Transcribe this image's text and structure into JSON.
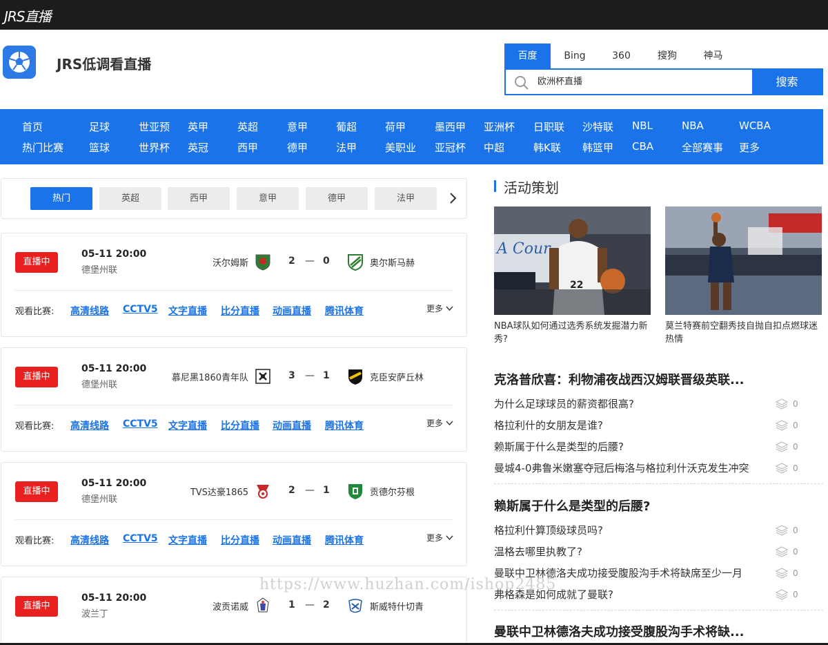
{
  "topbar": {
    "brand": "JRS直播"
  },
  "header": {
    "site_title": "JRS低调看直播",
    "brand_color": "#1a73e8",
    "search": {
      "engines": [
        "百度",
        "Bing",
        "360",
        "搜狗",
        "神马"
      ],
      "active_engine": "百度",
      "query": "欧洲杯直播",
      "button": "搜索"
    }
  },
  "nav": {
    "row1": [
      "首页",
      "足球",
      "世亚预",
      "英甲",
      "英超",
      "意甲",
      "葡超",
      "荷甲",
      "墨西甲",
      "亚洲杯",
      "日职联",
      "沙特联",
      "NBL",
      "NBA",
      "WCBA"
    ],
    "row2": [
      "热门比赛",
      "篮球",
      "世界杯",
      "英冠",
      "西甲",
      "德甲",
      "法甲",
      "美职业",
      "亚冠杯",
      "中超",
      "韩K联",
      "韩篮甲",
      "CBA",
      "全部赛事",
      "更多"
    ]
  },
  "filter_tabs": [
    "热门",
    "英超",
    "西甲",
    "意甲",
    "德甲",
    "法甲"
  ],
  "matches": [
    {
      "status": "直播中",
      "time": "05-11 20:00",
      "league": "德堡州联",
      "home": "沃尔姆斯",
      "home_score": "2",
      "away_score": "0",
      "away": "奥尔斯马赫"
    },
    {
      "status": "直播中",
      "time": "05-11 20:00",
      "league": "德堡州联",
      "home": "慕尼黑1860青年队",
      "home_score": "3",
      "away_score": "1",
      "away": "克臣安萨丘林"
    },
    {
      "status": "直播中",
      "time": "05-11 20:00",
      "league": "德堡州联",
      "home": "TVS达豪1865",
      "home_score": "2",
      "away_score": "1",
      "away": "贡德尔芬根"
    },
    {
      "status": "直播中",
      "time": "05-11 20:00",
      "league": "波兰丁",
      "home": "波贡诺威",
      "home_score": "1",
      "away_score": "2",
      "away": "斯威特什切青"
    }
  ],
  "watch": {
    "label": "观看比赛:",
    "links": [
      "高清线路",
      "CCTV5",
      "文字直播",
      "比分直播",
      "动画直播",
      "腾讯体育"
    ],
    "more": "更多"
  },
  "sidebar": {
    "section_title": "活动策划",
    "promos": [
      {
        "caption": "NBA球队如何通过选秀系统发掘潜力新秀?"
      },
      {
        "caption": "莫兰特赛前空翻秀技自抛自扣点燃球迷热情"
      }
    ],
    "news_groups": [
      {
        "headline": "克洛普欣喜：利物浦夜战西汉姆联晋级英联...",
        "items": [
          {
            "title": "为什么足球球员的薪资都很高?",
            "count": "0"
          },
          {
            "title": "格拉利什的女朋友是谁?",
            "count": "0"
          },
          {
            "title": "赖斯属于什么是类型的后腰?",
            "count": "0"
          },
          {
            "title": "曼城4-0弗鲁米嫩塞夺冠后梅洛与格拉利什沃克发生冲突",
            "count": "0"
          }
        ]
      },
      {
        "headline": "赖斯属于什么是类型的后腰?",
        "items": [
          {
            "title": "格拉利什算顶级球员吗?",
            "count": "0"
          },
          {
            "title": "温格去哪里执教了?",
            "count": "0"
          },
          {
            "title": "曼联中卫林德洛夫成功接受腹股沟手术将缺席至少一月",
            "count": "0"
          },
          {
            "title": "弗格森是如何成就了曼联?",
            "count": "0"
          }
        ]
      },
      {
        "headline": "曼联中卫林德洛夫成功接受腹股沟手术将缺...",
        "items": []
      }
    ]
  },
  "watermark": "https://www.huzhan.com/ishop2485"
}
